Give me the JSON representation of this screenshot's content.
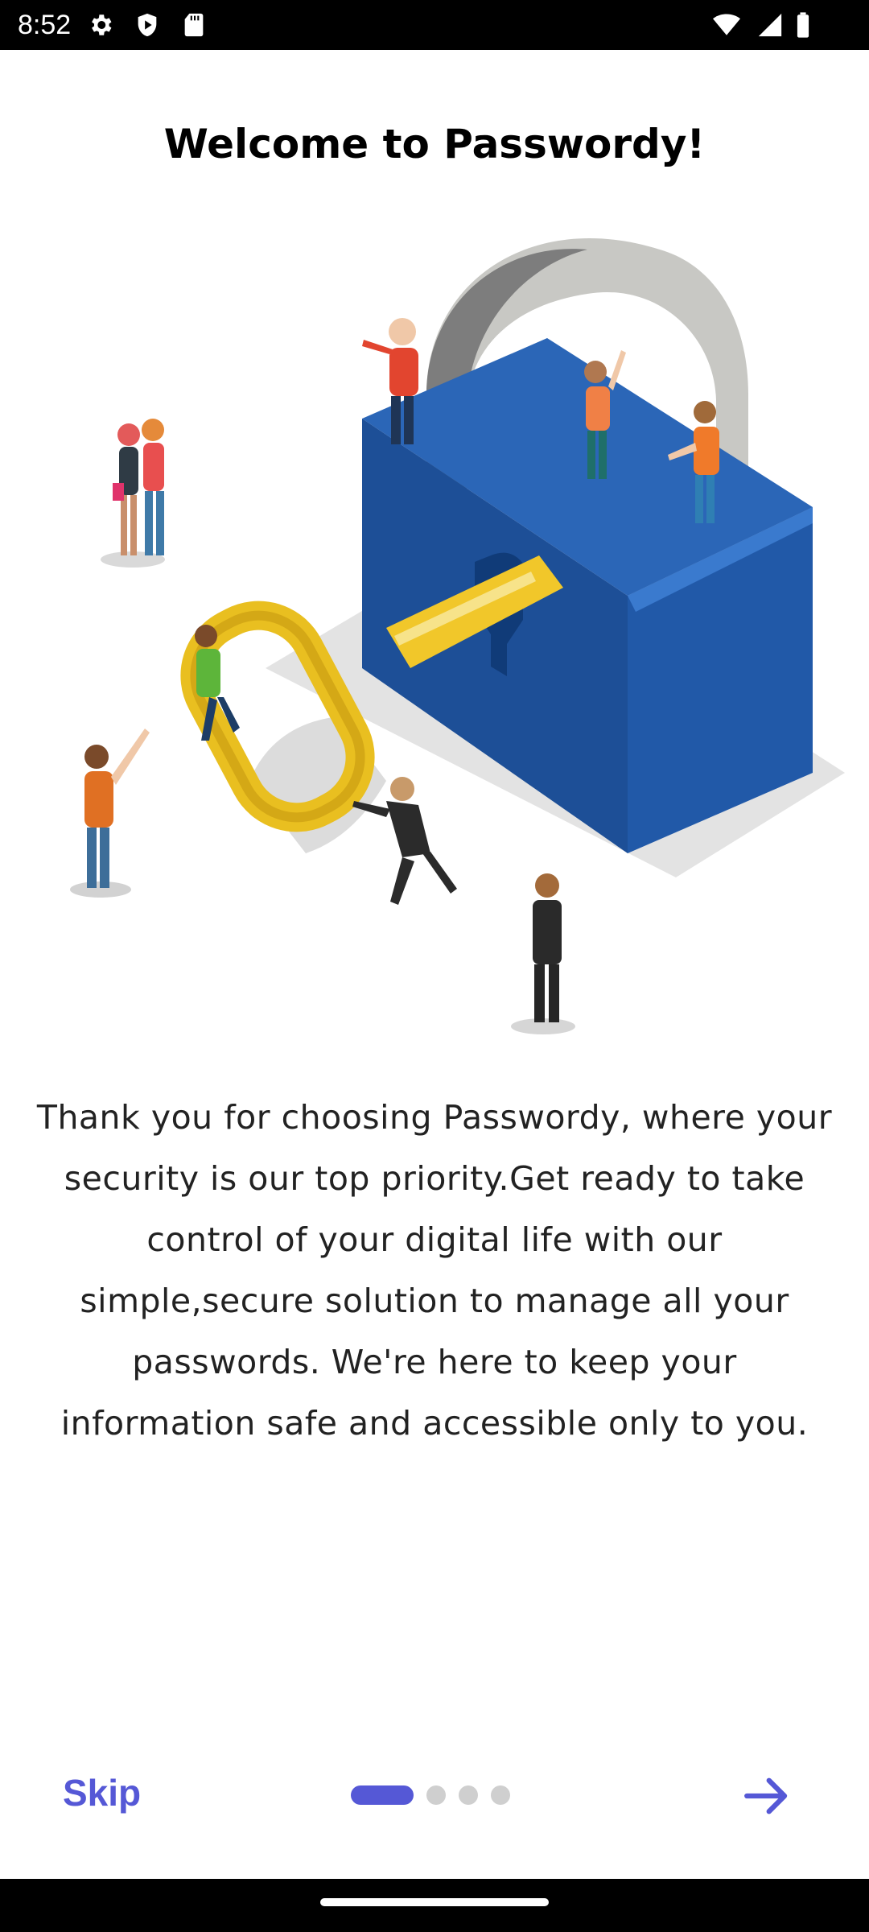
{
  "status_bar": {
    "time": "8:52",
    "icons_left": [
      "settings-icon",
      "play-protect-icon",
      "sd-card-icon"
    ],
    "icons_right": [
      "wifi-icon",
      "signal-icon",
      "battery-icon"
    ]
  },
  "onboarding": {
    "title": "Welcome to Passwordy!",
    "description": "Thank you for choosing Passwordy, where your security is our top priority.Get ready to take control of your digital life with our simple,secure solution to manage all your passwords. We're here to keep your information safe and accessible only to you.",
    "illustration": "padlock-with-key-and-people",
    "skip_label": "Skip",
    "next_icon": "arrow-right-icon",
    "page_count": 4,
    "current_page": 1,
    "accent_color": "#5558d6"
  }
}
